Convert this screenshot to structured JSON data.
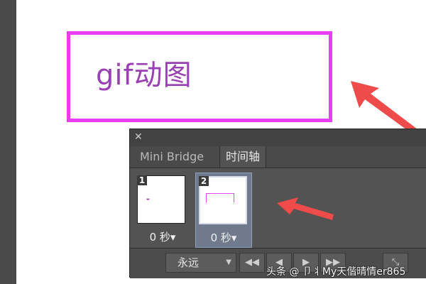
{
  "canvas": {
    "text": "gif动图"
  },
  "panel": {
    "close_icon": "close-icon",
    "tabs": [
      {
        "label": "Mini Bridge",
        "active": false
      },
      {
        "label": "时间轴",
        "active": true
      }
    ],
    "frames": [
      {
        "number": "1",
        "delay": "0 秒▾",
        "selected": false
      },
      {
        "number": "2",
        "delay": "0 秒▾",
        "selected": true
      }
    ],
    "loop": {
      "value": "永远",
      "caret": "▼"
    },
    "controls": [
      {
        "icon": "first-frame-icon",
        "glyph": "◀◀"
      },
      {
        "icon": "prev-frame-icon",
        "glyph": "◀"
      },
      {
        "icon": "play-icon",
        "glyph": "▶"
      },
      {
        "icon": "next-frame-icon",
        "glyph": "▶▶"
      },
      {
        "icon": "tween-icon",
        "glyph": "⤡"
      }
    ]
  },
  "watermark": "头条 @ 卩丬My天偕晴情er865",
  "colors": {
    "highlight_border": "#ea3df2",
    "canvas_text": "#9a3fb4",
    "arrow": "#f04b4b",
    "panel_bg": "#535353"
  }
}
